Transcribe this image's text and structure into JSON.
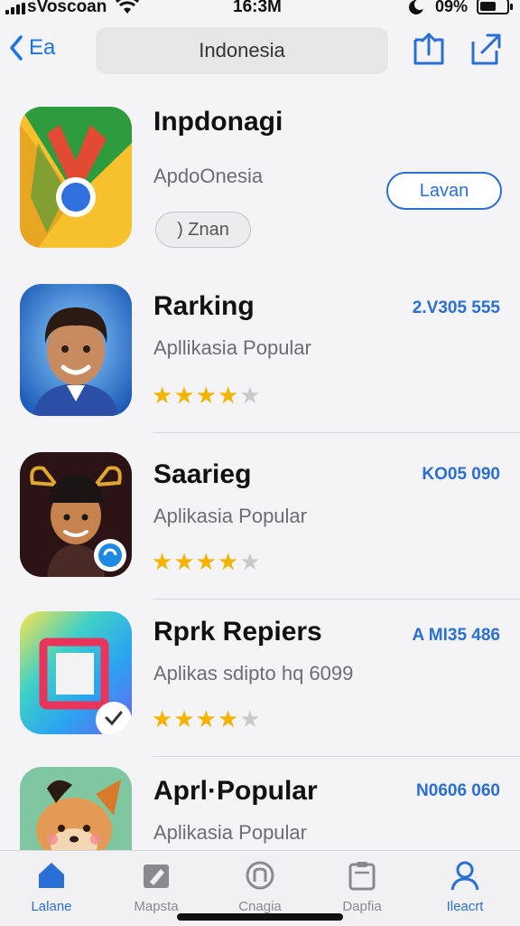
{
  "status": {
    "carrier": "sVoscoan",
    "time": "16:3M",
    "battery": "09%",
    "battery_level": 0.6
  },
  "nav": {
    "back_label": "Ea",
    "search_title": "Indonesia"
  },
  "apps": [
    {
      "title": "Inpdonagi",
      "subtitle": "ApdoOnesia",
      "action_label": "Lavan",
      "tag_label": ") Znan",
      "icon": "chrome-logo-icon"
    },
    {
      "title": "Rarking",
      "subtitle": "Apllikasia Popular",
      "price": "2.V305 555",
      "rating": 4,
      "icon": "man-avatar-icon"
    },
    {
      "title": "Saarieg",
      "subtitle": "Aplikasia Popular",
      "price": "KO05 090",
      "rating": 4,
      "icon": "character-avatar-icon"
    },
    {
      "title": "Rprk Repiers",
      "subtitle": "Aplikas sdipto hq 6099",
      "price": "A MI35 486",
      "rating": 4,
      "icon": "gradient-frame-icon"
    },
    {
      "title": "Aprl·Popular",
      "subtitle": "Aplikasia Popular",
      "price": "N0606 060",
      "icon": "fox-avatar-icon"
    }
  ],
  "tabs": [
    {
      "label": "Lalane",
      "icon": "home-icon",
      "active": true
    },
    {
      "label": "Mapsta",
      "icon": "edit-icon",
      "active": false
    },
    {
      "label": "Cnagia",
      "icon": "games-icon",
      "active": false
    },
    {
      "label": "Dapfia",
      "icon": "clipboard-icon",
      "active": false
    },
    {
      "label": "Ileacrt",
      "icon": "person-icon",
      "active": false
    }
  ],
  "colors": {
    "accent": "#2a6fd6",
    "star": "#f5b301"
  }
}
